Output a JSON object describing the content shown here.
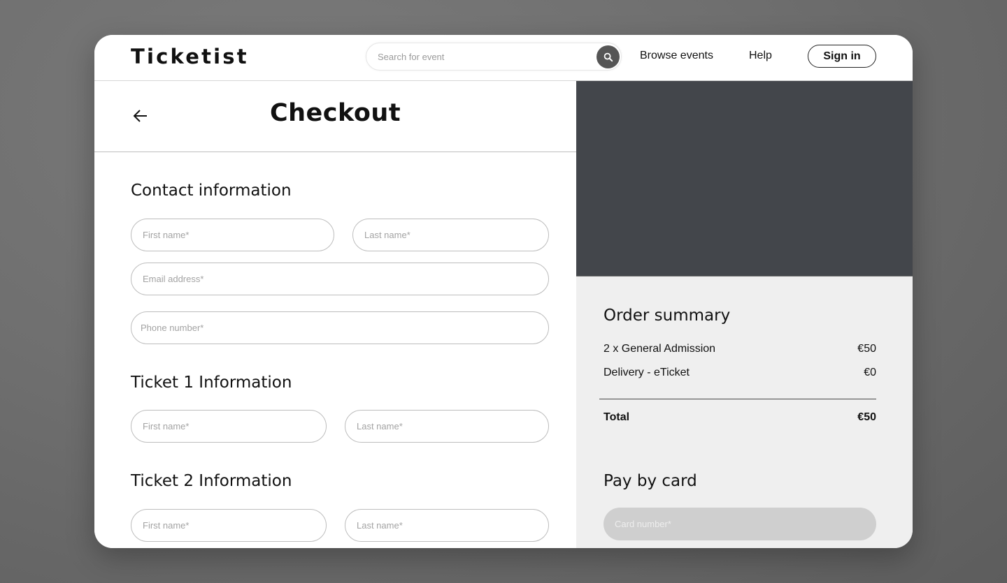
{
  "header": {
    "logo": "Ticketist",
    "search": {
      "placeholder": "Search for event",
      "value": "",
      "icon": "search-icon"
    },
    "nav": [
      {
        "label": "Browse events"
      },
      {
        "label": "Help"
      }
    ],
    "signin_label": "Sign in"
  },
  "checkout": {
    "back_icon": "arrow-left-icon",
    "title": "Checkout",
    "contact": {
      "title": "Contact information",
      "first_name": {
        "placeholder": "First name*",
        "value": ""
      },
      "last_name": {
        "placeholder": "Last name*",
        "value": ""
      },
      "email": {
        "placeholder": "Email address*",
        "value": ""
      },
      "phone": {
        "placeholder": "Phone number*",
        "value": ""
      }
    },
    "tickets": [
      {
        "title": "Ticket 1 Information",
        "first_name": {
          "placeholder": "First name*",
          "value": ""
        },
        "last_name": {
          "placeholder": "Last name*",
          "value": ""
        }
      },
      {
        "title": "Ticket 2 Information",
        "first_name": {
          "placeholder": "First name*",
          "value": ""
        },
        "last_name": {
          "placeholder": "Last name*",
          "value": ""
        }
      }
    ]
  },
  "order_summary": {
    "title": "Order summary",
    "items": [
      {
        "label": "2 x General Admission",
        "price": "€50"
      },
      {
        "label": "Delivery - eTicket",
        "price": "€0"
      }
    ],
    "total": {
      "label": "Total",
      "price": "€50"
    }
  },
  "payment": {
    "title": "Pay by card",
    "card_number": {
      "placeholder": "Card number*",
      "value": ""
    }
  },
  "colors": {
    "hero_placeholder": "#43464b",
    "summary_bg": "#efefef",
    "card_field_bg": "#cfcfcf",
    "search_button": "#555555"
  }
}
